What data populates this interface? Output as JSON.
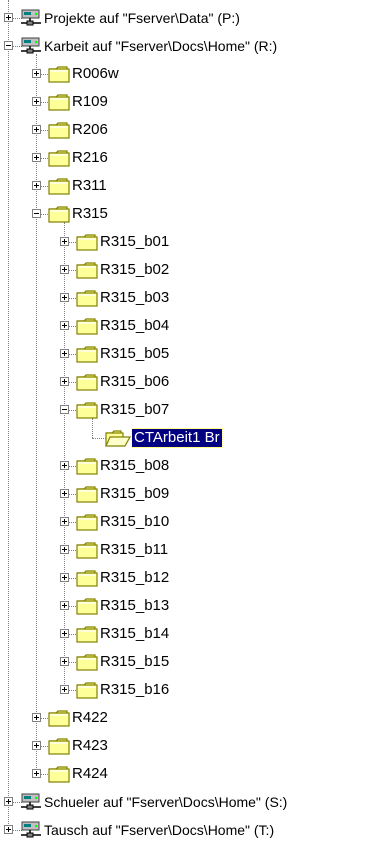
{
  "tree": [
    {
      "label": "Projekte auf \"Fserver\\Data\" (P:)",
      "icon": "network-drive-icon",
      "level": 0,
      "toggle": "plus"
    },
    {
      "label": "Karbeit auf \"Fserver\\Docs\\Home\" (R:)",
      "icon": "network-drive-icon",
      "level": 0,
      "toggle": "minus"
    },
    {
      "label": "R006w",
      "icon": "folder-icon",
      "level": 1,
      "toggle": "plus"
    },
    {
      "label": "R109",
      "icon": "folder-icon",
      "level": 1,
      "toggle": "plus"
    },
    {
      "label": "R206",
      "icon": "folder-icon",
      "level": 1,
      "toggle": "plus"
    },
    {
      "label": "R216",
      "icon": "folder-icon",
      "level": 1,
      "toggle": "plus"
    },
    {
      "label": "R311",
      "icon": "folder-icon",
      "level": 1,
      "toggle": "plus"
    },
    {
      "label": "R315",
      "icon": "folder-icon",
      "level": 1,
      "toggle": "minus"
    },
    {
      "label": "R315_b01",
      "icon": "folder-icon",
      "level": 2,
      "toggle": "plus"
    },
    {
      "label": "R315_b02",
      "icon": "folder-icon",
      "level": 2,
      "toggle": "plus"
    },
    {
      "label": "R315_b03",
      "icon": "folder-icon",
      "level": 2,
      "toggle": "plus"
    },
    {
      "label": "R315_b04",
      "icon": "folder-icon",
      "level": 2,
      "toggle": "plus"
    },
    {
      "label": "R315_b05",
      "icon": "folder-icon",
      "level": 2,
      "toggle": "plus"
    },
    {
      "label": "R315_b06",
      "icon": "folder-icon",
      "level": 2,
      "toggle": "plus"
    },
    {
      "label": "R315_b07",
      "icon": "folder-icon",
      "level": 2,
      "toggle": "minus"
    },
    {
      "label": "CTArbeit1 Br",
      "icon": "open-folder-icon",
      "level": 3,
      "toggle": "none",
      "selected": true
    },
    {
      "label": "R315_b08",
      "icon": "folder-icon",
      "level": 2,
      "toggle": "plus"
    },
    {
      "label": "R315_b09",
      "icon": "folder-icon",
      "level": 2,
      "toggle": "plus"
    },
    {
      "label": "R315_b10",
      "icon": "folder-icon",
      "level": 2,
      "toggle": "plus"
    },
    {
      "label": "R315_b11",
      "icon": "folder-icon",
      "level": 2,
      "toggle": "plus"
    },
    {
      "label": "R315_b12",
      "icon": "folder-icon",
      "level": 2,
      "toggle": "plus"
    },
    {
      "label": "R315_b13",
      "icon": "folder-icon",
      "level": 2,
      "toggle": "plus"
    },
    {
      "label": "R315_b14",
      "icon": "folder-icon",
      "level": 2,
      "toggle": "plus"
    },
    {
      "label": "R315_b15",
      "icon": "folder-icon",
      "level": 2,
      "toggle": "plus"
    },
    {
      "label": "R315_b16",
      "icon": "folder-icon",
      "level": 2,
      "toggle": "plus"
    },
    {
      "label": "R422",
      "icon": "folder-icon",
      "level": 1,
      "toggle": "plus"
    },
    {
      "label": "R423",
      "icon": "folder-icon",
      "level": 1,
      "toggle": "plus"
    },
    {
      "label": "R424",
      "icon": "folder-icon",
      "level": 1,
      "toggle": "plus"
    },
    {
      "label": "Schueler auf \"Fserver\\Docs\\Home\" (S:)",
      "icon": "network-drive-icon",
      "level": 0,
      "toggle": "plus"
    },
    {
      "label": "Tausch auf \"Fserver\\Docs\\Home\" (T:)",
      "icon": "network-drive-icon",
      "level": 0,
      "toggle": "plus"
    }
  ],
  "colors": {
    "selection": "#000080",
    "folder_fill": "#ffff99",
    "folder_outline": "#808000",
    "tree_lines": "#808080"
  }
}
